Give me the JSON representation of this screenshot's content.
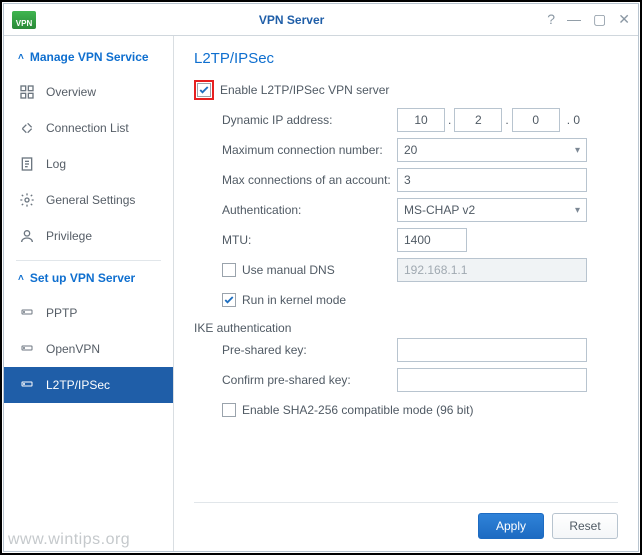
{
  "window": {
    "title": "VPN Server",
    "badge": "VPN"
  },
  "sidebar": {
    "section1": "Manage VPN Service",
    "section2": "Set up VPN Server",
    "items": [
      {
        "label": "Overview"
      },
      {
        "label": "Connection List"
      },
      {
        "label": "Log"
      },
      {
        "label": "General Settings"
      },
      {
        "label": "Privilege"
      }
    ],
    "servers": [
      {
        "label": "PPTP"
      },
      {
        "label": "OpenVPN"
      },
      {
        "label": "L2TP/IPSec"
      }
    ]
  },
  "page": {
    "title": "L2TP/IPSec",
    "enable_label": "Enable L2TP/IPSec VPN server",
    "dynamic_ip_label": "Dynamic IP address:",
    "ip": {
      "a": "10",
      "b": "2",
      "c": "0"
    },
    "end_zero": ". 0",
    "max_conn_label": "Maximum connection number:",
    "max_conn_value": "20",
    "max_acc_label": "Max connections of an account:",
    "max_acc_value": "3",
    "auth_label": "Authentication:",
    "auth_value": "MS-CHAP v2",
    "mtu_label": "MTU:",
    "mtu_value": "1400",
    "manual_dns_label": "Use manual DNS",
    "dns_value": "192.168.1.1",
    "kernel_label": "Run in kernel mode",
    "ike_label": "IKE authentication",
    "psk_label": "Pre-shared key:",
    "psk_confirm_label": "Confirm pre-shared key:",
    "sha2_label": "Enable SHA2-256 compatible mode (96 bit)"
  },
  "footer": {
    "apply": "Apply",
    "reset": "Reset"
  },
  "watermark": "www.wintips.org"
}
